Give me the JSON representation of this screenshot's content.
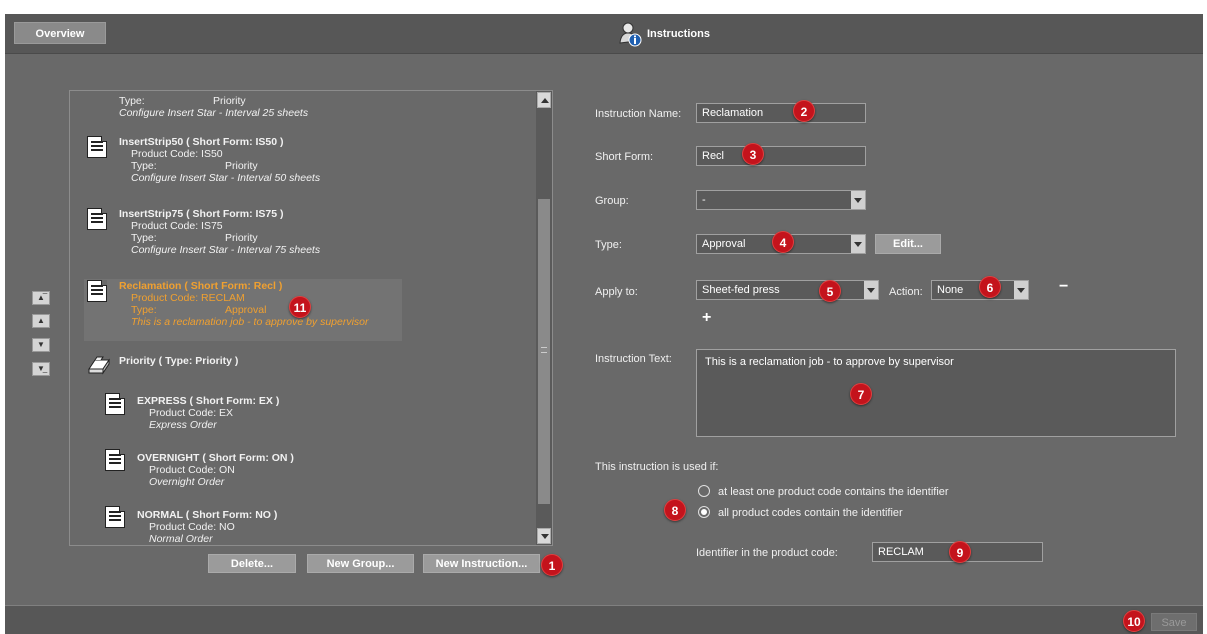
{
  "header": {
    "overview_tab": "Overview",
    "title": "Instructions"
  },
  "list": {
    "items": [
      {
        "type_label": "Type:",
        "type_value": "Priority",
        "description": "Configure Insert Star - Interval 25 sheets"
      },
      {
        "title": "InsertStrip50 ( Short Form: IS50 )",
        "code_label": "Product Code:",
        "code": "IS50",
        "type_label": "Type:",
        "type_value": "Priority",
        "description": "Configure Insert Star - Interval 50 sheets"
      },
      {
        "title": "InsertStrip75 ( Short Form: IS75 )",
        "code_label": "Product Code:",
        "code": "IS75",
        "type_label": "Type:",
        "type_value": "Priority",
        "description": "Configure Insert Star - Interval 75 sheets"
      },
      {
        "title": "Reclamation ( Short Form: Recl )",
        "code_label": "Product Code:",
        "code": "RECLAM",
        "type_label": "Type:",
        "type_value": "Approval",
        "description": "This is a reclamation job - to approve by supervisor"
      },
      {
        "title": "Priority ( Type: Priority )"
      },
      {
        "title": "EXPRESS ( Short Form: EX )",
        "code_label": "Product Code:",
        "code": "EX",
        "description": "Express Order"
      },
      {
        "title": "OVERNIGHT ( Short Form: ON )",
        "code_label": "Product Code:",
        "code": "ON",
        "description": "Overnight Order"
      },
      {
        "title": "NORMAL ( Short Form: NO )",
        "code_label": "Product Code:",
        "code": "NO",
        "description": "Normal Order"
      }
    ],
    "buttons": {
      "delete": "Delete...",
      "new_group": "New Group...",
      "new_instruction": "New Instruction..."
    }
  },
  "form": {
    "name_label": "Instruction Name:",
    "name_value": "Reclamation",
    "short_label": "Short Form:",
    "short_value": "Recl",
    "group_label": "Group:",
    "group_value": "-",
    "type_label": "Type:",
    "type_value": "Approval",
    "edit_button": "Edit...",
    "apply_label": "Apply to:",
    "apply_value": "Sheet-fed press",
    "action_label": "Action:",
    "action_value": "None",
    "minus": "−",
    "plus": "+",
    "text_label": "Instruction Text:",
    "text_value": "This is a reclamation job - to approve by supervisor",
    "used_if_label": "This instruction is used if:",
    "option_any": "at least one product code contains the identifier",
    "option_all": "all product codes contain the identifier",
    "identifier_label": "Identifier in the product code:",
    "identifier_value": "RECLAM"
  },
  "footer": {
    "save": "Save"
  },
  "badges": [
    "1",
    "2",
    "3",
    "4",
    "5",
    "6",
    "7",
    "8",
    "9",
    "10",
    "11"
  ],
  "colors": {
    "background": "#696969",
    "bar": "#575757",
    "selected_text": "#f0a030",
    "badge": "#c4131c"
  }
}
